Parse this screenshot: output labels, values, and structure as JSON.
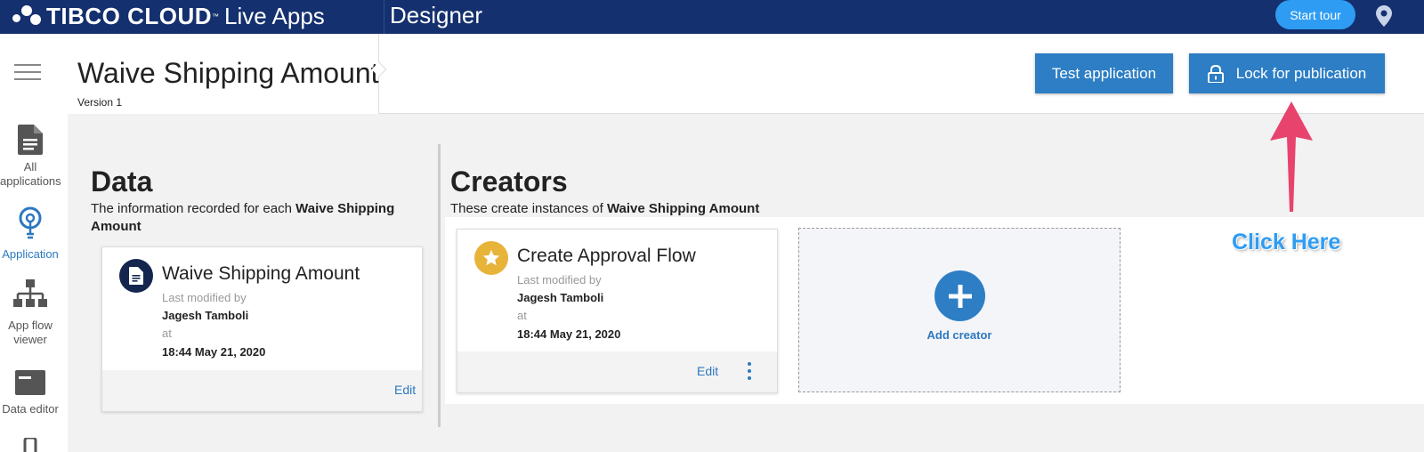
{
  "topbar": {
    "brand": "TIBCO CLOUD",
    "product": "Live Apps",
    "section": "Designer",
    "start_tour": "Start tour"
  },
  "nav": {
    "items": [
      {
        "label": "All applications",
        "icon": "document-icon"
      },
      {
        "label": "Application",
        "icon": "lightbulb-icon",
        "active": true
      },
      {
        "label": "App flow viewer",
        "icon": "hierarchy-icon"
      },
      {
        "label": "Data editor",
        "icon": "data-editor-icon"
      }
    ]
  },
  "header": {
    "title": "Waive Shipping Amount",
    "version": "Version 1",
    "test_button": "Test application",
    "lock_button": "Lock for publication"
  },
  "data_section": {
    "heading": "Data",
    "subtitle_prefix": "The information recorded for each",
    "subtitle_bold": "Waive Shipping Amount",
    "card": {
      "title": "Waive Shipping Amount",
      "modified_label": "Last modified by",
      "author": "Jagesh Tamboli",
      "at_label": "at",
      "timestamp": "18:44 May 21, 2020",
      "edit": "Edit"
    }
  },
  "creators_section": {
    "heading": "Creators",
    "subtitle_prefix": "These create instances of",
    "subtitle_bold": "Waive Shipping Amount",
    "card": {
      "title": "Create Approval Flow",
      "modified_label": "Last modified by",
      "author": "Jagesh Tamboli",
      "at_label": "at",
      "timestamp": "18:44 May 21, 2020",
      "edit": "Edit"
    },
    "add_label": "Add creator"
  },
  "annotation": {
    "text": "Click Here",
    "color": "#e8436d"
  },
  "colors": {
    "topbar": "#14306e",
    "accent": "#2d7ec4",
    "tour": "#2e9cf3",
    "star": "#e8b339"
  }
}
